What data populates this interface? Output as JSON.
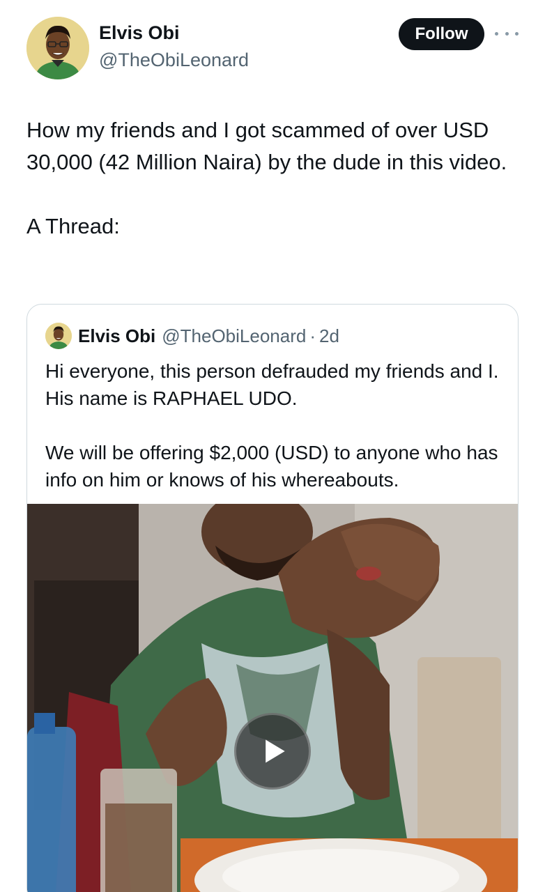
{
  "tweet": {
    "author_name": "Elvis Obi",
    "author_handle": "@TheObiLeonard",
    "follow_label": "Follow",
    "more_icon": "more-horizontal-icon",
    "text": "How my friends and I got scammed of over USD 30,000 (42 Million Naira) by the dude in this video.\n\nA Thread:"
  },
  "quoted_tweet": {
    "author_name": "Elvis Obi",
    "author_handle": "@TheObiLeonard",
    "separator": "·",
    "time": "2d",
    "text": "Hi everyone, this person defrauded my friends and I. His name is RAPHAEL UDO.\n\nWe will be offering $2,000 (USD) to anyone who has info on him or knows of his whereabouts.",
    "media": {
      "type": "video",
      "play_icon": "play-icon"
    }
  },
  "colors": {
    "text_primary": "#0f1419",
    "text_secondary": "#536471",
    "follow_bg": "#0f1419",
    "card_border": "#cfd9de"
  }
}
